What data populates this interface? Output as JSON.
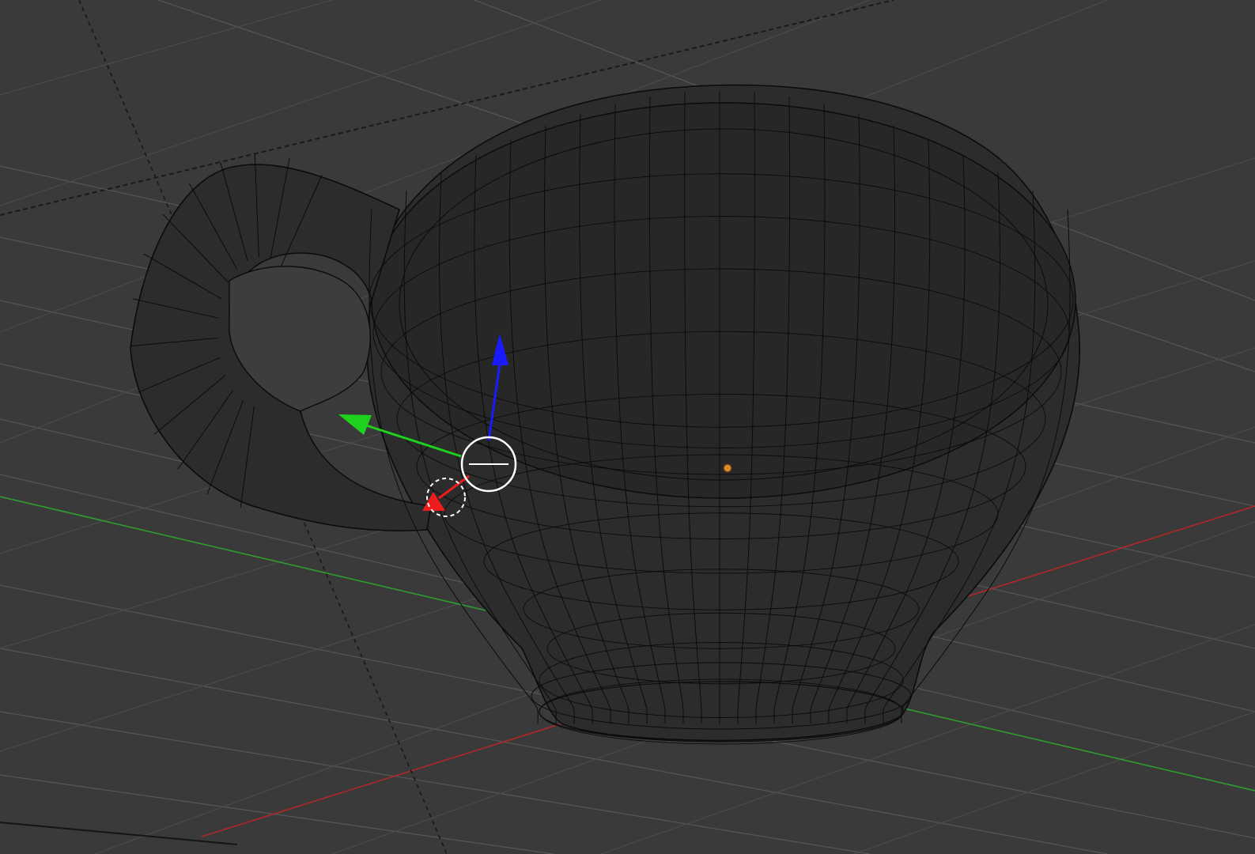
{
  "viewport": {
    "background": "#3a3a3a",
    "grid_color": "#555555",
    "grid_color_dim": "#4a4a4a",
    "x_axis_color": "#b02828",
    "y_axis_color": "#2f9e2f",
    "mesh_fill": "#2c2c2c",
    "mesh_fill_inner": "#272727",
    "wire_color": "#0b0b0b",
    "origin_color": "#d9892b"
  },
  "gizmo": {
    "mode": "translate",
    "z_handle_color": "#1a1aff",
    "y_handle_color": "#1fd11f",
    "x_handle_color": "#ee1c1c",
    "ring_color": "#ffffff"
  },
  "object": {
    "type": "mesh",
    "shape": "cup",
    "display": "wireframe"
  }
}
